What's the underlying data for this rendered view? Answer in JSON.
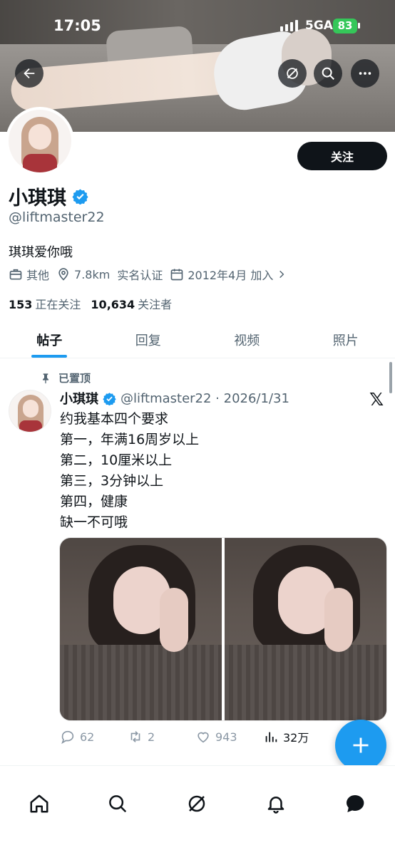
{
  "status_bar": {
    "time": "17:05",
    "network": "5GA",
    "battery": "83"
  },
  "profile": {
    "display_name": "小琪琪",
    "handle": "@liftmaster22",
    "follow_label": "关注",
    "bio": "琪琪爱你哦",
    "meta": {
      "category": "其他",
      "distance": "7.8km",
      "verification": "实名认证",
      "joined": "2012年4月 加入"
    },
    "following_count": "153",
    "following_label": "正在关注",
    "followers_count": "10,634",
    "followers_label": "关注者"
  },
  "tabs": [
    {
      "label": "帖子",
      "active": true
    },
    {
      "label": "回复",
      "active": false
    },
    {
      "label": "视频",
      "active": false
    },
    {
      "label": "照片",
      "active": false
    }
  ],
  "post": {
    "pinned_label": "已置顶",
    "author": "小琪琪",
    "handle_date": "@liftmaster22 · 2026/1/31",
    "lines": [
      "约我基本四个要求",
      "第一，年满16周岁以上",
      "第二，10厘米以上",
      "第三，3分钟以上",
      "第四，健康",
      "缺一不可哦"
    ],
    "replies": "62",
    "reposts": "2",
    "likes": "943",
    "views": "32万"
  },
  "colors": {
    "accent": "#1d9bf0",
    "verified": "#1d9bf0",
    "text": "#0f1419",
    "muted": "#536471",
    "battery": "#35c759"
  },
  "icons": {
    "header": [
      "back-arrow-icon",
      "grok-icon",
      "search-icon",
      "more-icon"
    ],
    "meta": [
      "briefcase-icon",
      "location-pin-icon",
      "calendar-icon",
      "chevron-right-icon"
    ],
    "bottom_nav": [
      "home-icon",
      "search-icon",
      "grok-icon",
      "bell-icon",
      "chat-icon"
    ]
  }
}
